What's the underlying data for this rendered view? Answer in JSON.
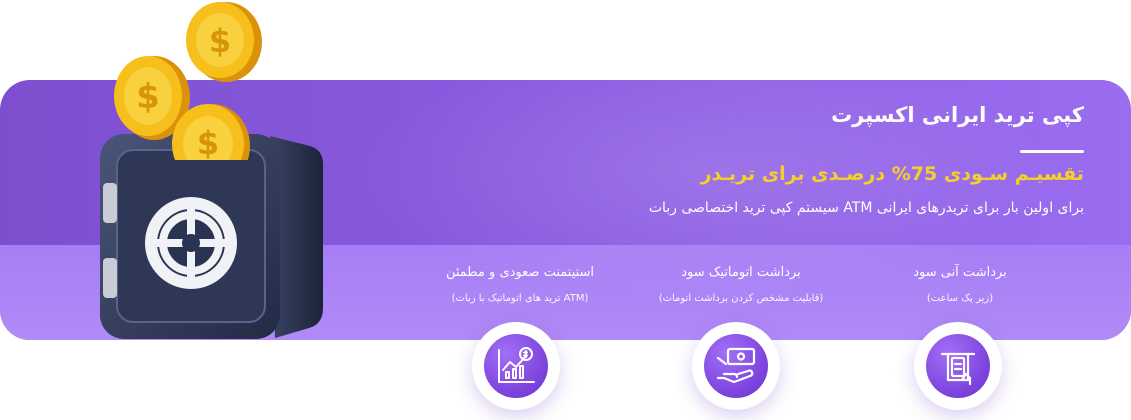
{
  "banner": {
    "title": "کپی ترید ایرانی اکسپرت",
    "headline": "تقسیـم سـودی  75% درصـدی برای تریـدر",
    "description": "برای اولین بار برای تریدرهای ایرانی ATM سیستم کپی ترید اختصاصی ربات"
  },
  "features": [
    {
      "title": "برداشت آنی سود",
      "subtitle": "(زیر یک ساعت)",
      "icon": "atm-withdraw-icon"
    },
    {
      "title": "برداشت اتوماتیک سود",
      "subtitle": "(قابلیت مشخص کردن برداشت اتومات)",
      "icon": "hand-money-icon"
    },
    {
      "title": "استیتمنت صعودی و مطمئن",
      "subtitle": "(ATM ترید های اتوماتیک با ربات)",
      "icon": "chart-growth-icon"
    }
  ],
  "colors": {
    "banner": "#8a5be0",
    "accent": "#f5d028",
    "icon_bg": "#7b3fe0"
  }
}
